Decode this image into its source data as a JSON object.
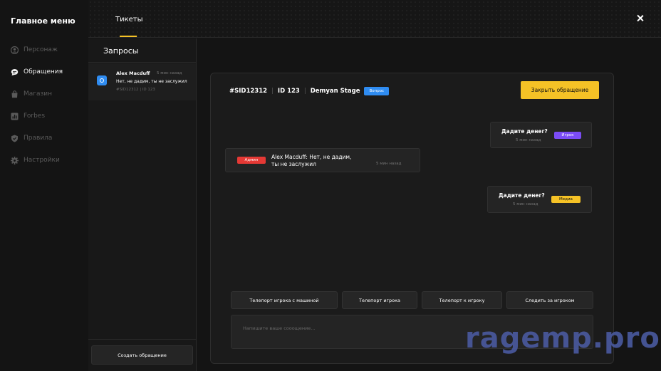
{
  "nav": {
    "title": "Главное меню",
    "items": [
      {
        "label": "Персонаж",
        "icon": "user-icon"
      },
      {
        "label": "Обращения",
        "icon": "chat-icon",
        "active": true
      },
      {
        "label": "Магазин",
        "icon": "bag-icon"
      },
      {
        "label": "Forbes",
        "icon": "chart-icon"
      },
      {
        "label": "Правила",
        "icon": "shield-icon"
      },
      {
        "label": "Настройки",
        "icon": "gear-icon"
      }
    ]
  },
  "header": {
    "tab": "Тикеты"
  },
  "requests": {
    "title": "Запросы",
    "items": [
      {
        "name": "Alex Macduff",
        "time": "5 мин назад",
        "message": "Нет, не дадим, ты не заслужил",
        "meta": "#SID12312  |  ID 123"
      }
    ],
    "create_label": "Создать обращение"
  },
  "ticket": {
    "sid": "#SID12312",
    "id": "ID 123",
    "player": "Demyan Stage",
    "badge": "Вопрос",
    "close_label": "Закрыть обращение",
    "messages": [
      {
        "text": "Дадите денег?",
        "time": "5 мин назад",
        "role": "Игрок"
      },
      {
        "text": "Alex Macduff: Нет, не дадим,",
        "text2": "ты не заслужил",
        "time": "5 мин назад",
        "role": "Админ"
      },
      {
        "text": "Дадите денег?",
        "time": "5 мин назад",
        "role": "Медиа"
      }
    ],
    "actions": [
      "Телепорт игрока с машиной",
      "Телепорт игрока",
      "Телепорт к игроку",
      "Следить за игроком"
    ],
    "input_placeholder": "Напишите ваше сооощение..."
  },
  "watermark": "ragemp.pro",
  "colors": {
    "accent": "#f5c226",
    "blue": "#2f8cf1",
    "purple": "#7b4cf5",
    "red": "#e53935"
  }
}
